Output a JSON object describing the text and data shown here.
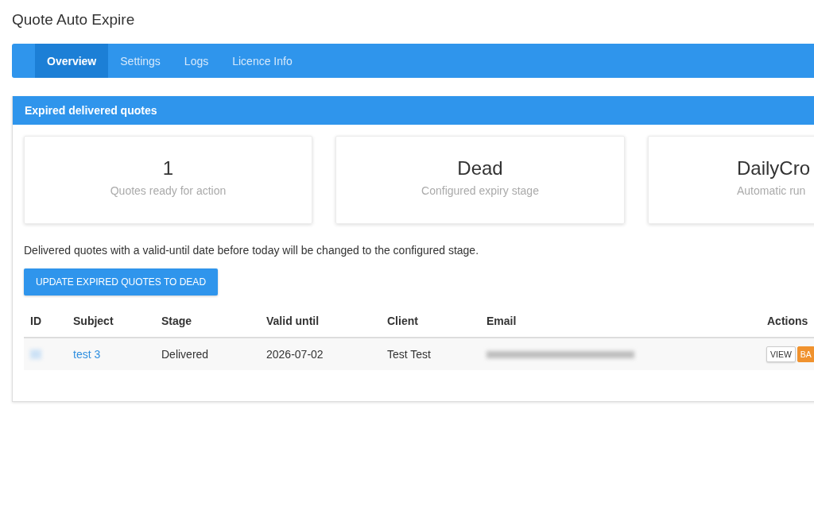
{
  "page_title": "Quote Auto Expire",
  "tabs": [
    {
      "label": "Overview",
      "selected": true
    },
    {
      "label": "Settings",
      "selected": false
    },
    {
      "label": "Logs",
      "selected": false
    },
    {
      "label": "Licence Info",
      "selected": false
    }
  ],
  "panel": {
    "title": "Expired delivered quotes",
    "stats": [
      {
        "value": "1",
        "label": "Quotes ready for action"
      },
      {
        "value": "Dead",
        "label": "Configured expiry stage"
      },
      {
        "value": "DailyCro",
        "label": "Automatic run"
      }
    ],
    "note": "Delivered quotes with a valid-until date before today will be changed to the configured stage.",
    "action_button": "UPDATE EXPIRED QUOTES TO DEAD",
    "table": {
      "columns": [
        "ID",
        "Subject",
        "Stage",
        "Valid until",
        "Client",
        "Email",
        "Actions"
      ],
      "rows": [
        {
          "id_blurred": true,
          "subject": "test 3",
          "stage": "Delivered",
          "valid_until": "2026-07-02",
          "client": "Test Test",
          "email_blurred": true,
          "actions": [
            {
              "label": "VIEW",
              "kind": "plain"
            },
            {
              "label": "BA",
              "kind": "warning"
            }
          ]
        }
      ]
    }
  }
}
